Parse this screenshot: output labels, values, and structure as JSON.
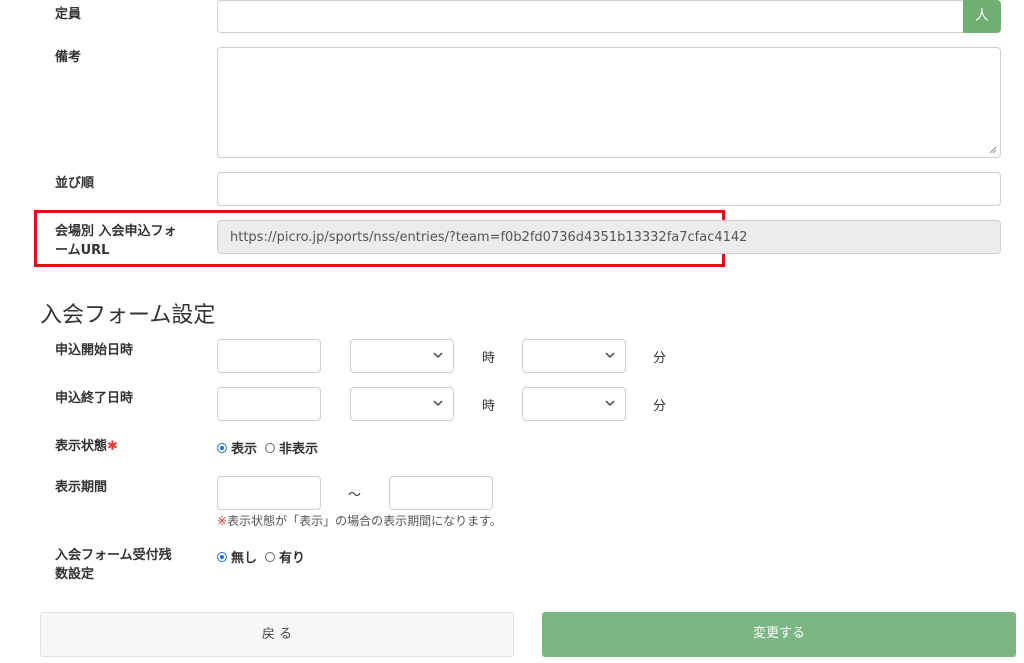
{
  "capacity": {
    "label": "定員",
    "value": "",
    "addon": "人"
  },
  "remarks": {
    "label": "備考",
    "value": ""
  },
  "sort_order": {
    "label": "並び順",
    "value": ""
  },
  "form_url": {
    "label_line1": "会場別 入会申込フォ",
    "label_line2": "ームURL",
    "value": "https://picro.jp/sports/nss/entries/?team=f0b2fd0736d4351b13332fa7cfac4142"
  },
  "section_title": "入会フォーム設定",
  "start_datetime": {
    "label": "申込開始日時",
    "hour_unit": "時",
    "minute_unit": "分"
  },
  "end_datetime": {
    "label": "申込終了日時",
    "hour_unit": "時",
    "minute_unit": "分"
  },
  "display_state": {
    "label": "表示状態",
    "required_mark": "✱",
    "options": [
      {
        "label": "表示",
        "selected": true
      },
      {
        "label": "非表示",
        "selected": false
      }
    ]
  },
  "display_period": {
    "label": "表示期間",
    "separator": "～",
    "note_mark": "※",
    "note": "表示状態が「表示」の場合の表示期間になります。"
  },
  "remaining_setting": {
    "label_line1": "入会フォーム受付残",
    "label_line2": "数設定",
    "options": [
      {
        "label": "無し",
        "selected": true
      },
      {
        "label": "有り",
        "selected": false
      }
    ]
  },
  "buttons": {
    "back": "戻 る",
    "submit": "変更する"
  },
  "colors": {
    "accent_green": "#7bb783",
    "highlight_red": "#e01010",
    "required_red": "#e53935"
  }
}
